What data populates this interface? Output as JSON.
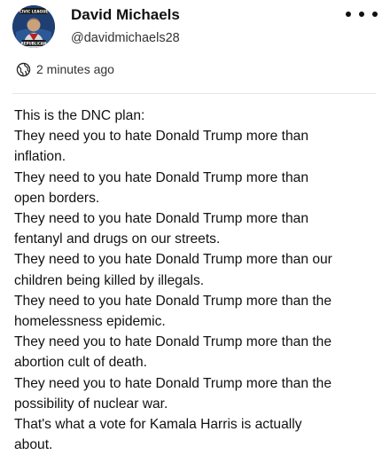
{
  "author": {
    "display_name": "David Michaels",
    "handle": "@davidmichaels28",
    "avatar_badge_top": "CIVIC LEAGUE",
    "avatar_badge_bottom": "REPUBLICAN"
  },
  "meta": {
    "timestamp": "2 minutes ago",
    "visibility_icon": "globe-icon",
    "more_icon": "more-options-icon"
  },
  "post": {
    "lines": [
      "This is the DNC plan:",
      "They need you to hate Donald Trump more than",
      "inflation.",
      "They need to you hate Donald Trump more than",
      "open borders.",
      "They need to you hate Donald Trump more than",
      "fentanyl and drugs on our streets.",
      "They need to you hate Donald Trump more than our",
      "children being killed by illegals.",
      "They need to you hate Donald Trump more than the",
      "homelessness epidemic.",
      "They need you to hate Donald Trump more than the",
      "abortion cult of death.",
      "They need you to hate Donald Trump more than the",
      "possibility of nuclear war.",
      "That's what a vote for Kamala Harris is actually",
      "about."
    ]
  },
  "colors": {
    "text": "#111111",
    "secondary_text": "#333333",
    "divider": "#e6e6e6",
    "avatar_bg": "#1f3f73"
  }
}
